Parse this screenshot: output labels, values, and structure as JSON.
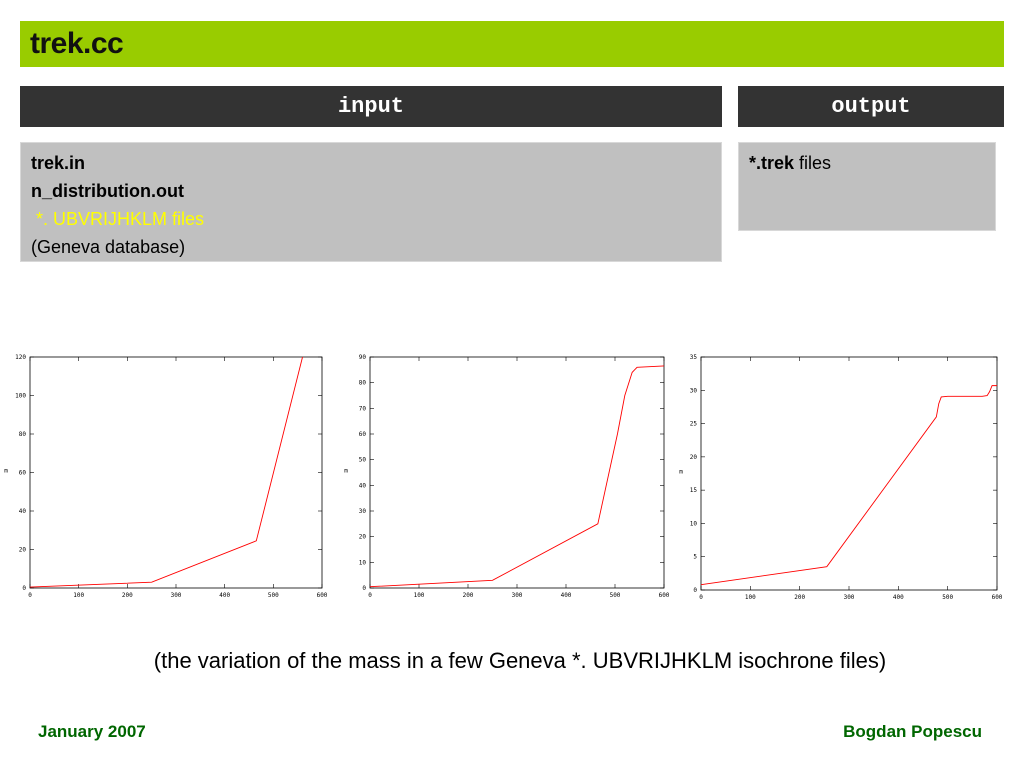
{
  "slide": {
    "title": "trek.cc",
    "input_header": "input",
    "output_header": "output",
    "input_box": {
      "line1": "trek.in",
      "line2": "n_distribution.out",
      "line3": " *. UBVRIJHKLM files",
      "line4": "(Geneva database)"
    },
    "output_box": {
      "bold": "*.trek",
      "rest": " files"
    },
    "caption": "(the variation of the mass in a few Geneva *. UBVRIJHKLM isochrone files)",
    "footer_left": "January 2007",
    "footer_right": "Bogdan Popescu"
  },
  "colors": {
    "title_bar": "#99cc00",
    "header_bg": "#333333",
    "box_bg": "#c0c0c0",
    "highlight_text": "#ffff00",
    "footer_text": "#006600",
    "line_color": "#ff0000"
  },
  "chart_data": [
    {
      "type": "line",
      "ylabel": "m",
      "xlim": [
        0,
        600
      ],
      "ylim": [
        0,
        120
      ],
      "xticks": [
        0,
        100,
        200,
        300,
        400,
        500,
        600
      ],
      "yticks": [
        0,
        20,
        40,
        60,
        80,
        100,
        120
      ],
      "x": [
        0,
        250,
        465,
        560
      ],
      "y": [
        0.5,
        3,
        24.5,
        120
      ]
    },
    {
      "type": "line",
      "ylabel": "m",
      "xlim": [
        0,
        600
      ],
      "ylim": [
        0,
        90
      ],
      "xticks": [
        0,
        100,
        200,
        300,
        400,
        500,
        600
      ],
      "yticks": [
        0,
        10,
        20,
        30,
        40,
        50,
        60,
        70,
        80,
        90
      ],
      "x": [
        0,
        250,
        465,
        505,
        520,
        535,
        545,
        600
      ],
      "y": [
        0.5,
        3,
        25,
        60,
        75,
        84,
        86,
        86.5
      ]
    },
    {
      "type": "line",
      "ylabel": "m",
      "xlim": [
        0,
        600
      ],
      "ylim": [
        0,
        35
      ],
      "xticks": [
        0,
        100,
        200,
        300,
        400,
        500,
        600
      ],
      "yticks": [
        0,
        5,
        10,
        15,
        20,
        25,
        30,
        35
      ],
      "x": [
        0,
        255,
        477,
        482,
        487,
        500,
        520,
        570,
        580,
        585,
        590,
        600
      ],
      "y": [
        0.8,
        3.5,
        26,
        28,
        29,
        29.1,
        29.1,
        29.1,
        29.2,
        29.8,
        30.7,
        30.7
      ]
    }
  ]
}
